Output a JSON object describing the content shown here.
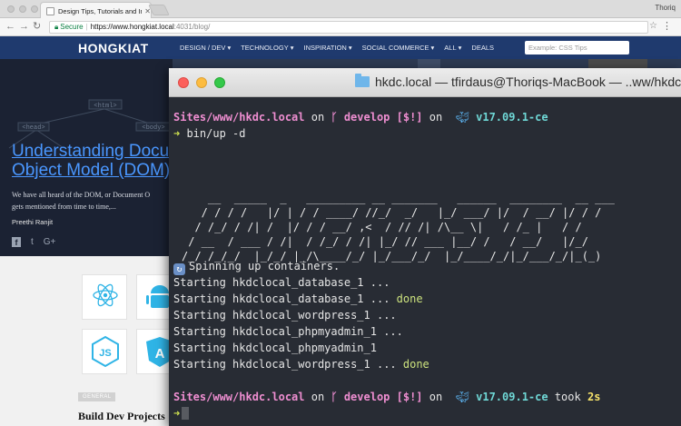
{
  "browser": {
    "tab_title": "Design Tips, Tutorials and Insp",
    "profile_name": "Thoriq",
    "secure_label": "Secure",
    "url_host": "https://www.hongkiat.local",
    "url_path": ":4031/blog/"
  },
  "site": {
    "logo": "HONGKIAT",
    "nav_items": [
      "DESIGN / DEV",
      "TECHNOLOGY",
      "INSPIRATION",
      "SOCIAL COMMERCE",
      "ALL",
      "DEALS"
    ],
    "search_placeholder": "Example: CSS Tips",
    "hero": {
      "title_line1": "Understanding Docum",
      "title_line2": "Object Model (DOM) in",
      "excerpt_line1": "We have all heard of the DOM, or Document O",
      "excerpt_line2": "gets mentioned from time to time,...",
      "author": "Preethi Ranjit",
      "tree_labels": [
        "<html>",
        "<head>",
        "<body>"
      ],
      "social": [
        "f",
        "t",
        "G+"
      ]
    },
    "tag": "GENERAL",
    "section_title": "Build Dev Projects"
  },
  "terminal": {
    "title": "hkdc.local — tfirdaus@Thoriqs-MacBook — ..ww/hkdc.local",
    "prompt1": {
      "path": "Sites/www/hkdc.local",
      "on1": " on ",
      "branch": " develop",
      "status": " [$!]",
      "on2": " on ",
      "docker": " v17.09.1-ce"
    },
    "command": "bin/up -d",
    "ascii_art": "    __  _____  _   _________ __ _______   ______  ________  __ ___\n   / / / /   |/ | / / ____/ //_/  _/   |_/ ___/ |/  / __/ |/ / /\n  / /_/ / /| /  |/ / / __/ ,<  / // /| /\\__ \\|   / /_ |   / /\n / __  / ___ / /|  / /_/ / /| |_/ // ___ |__/ /   / __/   |/_/\n/_/ /_/_/  |_/_/ |_/\\____/_/ |_/___/_/  |_/____/_/|_/___/_/|_(_)",
    "spinning": "Spinning up containers.",
    "starts": [
      {
        "text": "Starting hkdclocal_database_1 ...",
        "done": ""
      },
      {
        "text": "Starting hkdclocal_database_1 ... ",
        "done": "done"
      },
      {
        "text": "Starting hkdclocal_wordpress_1 ...",
        "done": ""
      },
      {
        "text": "Starting hkdclocal_phpmyadmin_1 ...",
        "done": ""
      },
      {
        "text": "Starting hkdclocal_phpmyadmin_1",
        "done": ""
      },
      {
        "text": "Starting hkdclocal_wordpress_1 ... ",
        "done": "done"
      }
    ],
    "prompt2": {
      "path": "Sites/www/hkdc.local",
      "on1": " on ",
      "branch": " develop",
      "status": " [$!]",
      "on2": " on ",
      "docker": " v17.09.1-ce",
      "took": " took ",
      "time": "2s"
    },
    "colors": {
      "background": "#282c34",
      "prompt_pink": "#ef8ed1",
      "docker_cyan": "#6fd8d6",
      "done_green": "#cde37e",
      "arrow_green": "#cfe24f",
      "time_yellow": "#f5e26a"
    }
  }
}
